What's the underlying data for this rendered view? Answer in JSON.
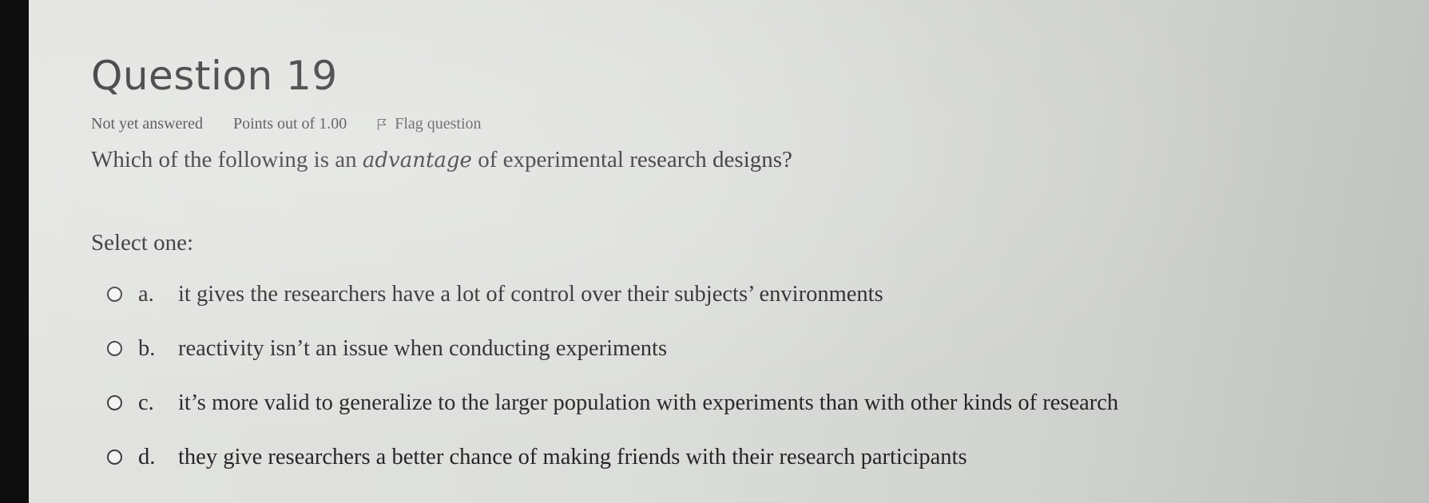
{
  "question": {
    "title": "Question 19",
    "state": "Not yet answered",
    "points": "Points out of 1.00",
    "flag_label": "Flag question",
    "text_before": "Which of the following is an ",
    "text_emphasis": "advantage",
    "text_after": " of experimental research designs?",
    "prompt": "Select one:",
    "answers": [
      {
        "letter": "a.",
        "text": "it gives the researchers have a lot of control over their subjects’ environments"
      },
      {
        "letter": "b.",
        "text": "reactivity isn’t an issue when conducting experiments"
      },
      {
        "letter": "c.",
        "text": "it’s more valid to generalize to the larger population with experiments than with other kinds of research"
      },
      {
        "letter": "d.",
        "text": "they give researchers a better chance of making friends with their research participants"
      }
    ]
  }
}
